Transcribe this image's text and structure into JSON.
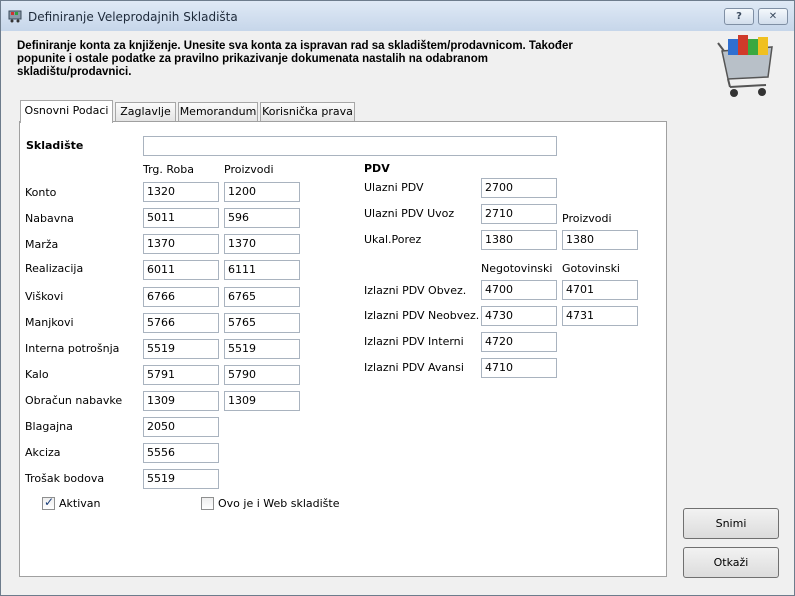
{
  "window": {
    "title": "Definiranje Veleprodajnih Skladišta",
    "help_icon": "?",
    "close_icon": "✕"
  },
  "hint": "Definiranje konta za knjiženje. Unesite sva konta za ispravan rad sa skladištem/prodavnicom. Također popunite i ostale podatke za pravilno prikazivanje dokumenata nastalih na odabranom skladištu/prodavnici.",
  "tabs": [
    "Osnovni Podaci",
    "Zaglavlje",
    "Memorandum",
    "Korisnička prava"
  ],
  "form": {
    "skladiste_label": "Skladište",
    "skladiste_value": "",
    "col_trg": "Trg. Roba",
    "col_proizvodi": "Proizvodi",
    "rows": [
      {
        "label": "Konto",
        "trg": "1320",
        "proizvodi": "1200"
      },
      {
        "label": "Nabavna",
        "trg": "5011",
        "proizvodi": "596"
      },
      {
        "label": "Marža",
        "trg": "1370",
        "proizvodi": "1370"
      },
      {
        "label": "Realizacija",
        "trg": "6011",
        "proizvodi": "6111"
      },
      {
        "label": "Viškovi",
        "trg": "6766",
        "proizvodi": "6765"
      },
      {
        "label": "Manjkovi",
        "trg": "5766",
        "proizvodi": "5765"
      },
      {
        "label": "Interna potrošnja",
        "trg": "5519",
        "proizvodi": "5519"
      },
      {
        "label": "Kalo",
        "trg": "5791",
        "proizvodi": "5790"
      },
      {
        "label": "Obračun nabavke",
        "trg": "1309",
        "proizvodi": "1309"
      },
      {
        "label": "Blagajna",
        "trg": "2050"
      },
      {
        "label": "Akciza",
        "trg": "5556"
      },
      {
        "label": "Trošak bodova",
        "trg": "5519"
      }
    ],
    "pdv": {
      "title": "PDV",
      "ulazni_label": "Ulazni PDV",
      "ulazni": "2700",
      "ulazni_uvoz_label": "Ulazni PDV Uvoz",
      "ulazni_uvoz": "2710",
      "proizvodi_label": "Proizvodi",
      "ukal_label": "Ukal.Porez",
      "ukal": "1380",
      "ukal_proizvodi": "1380",
      "col_negotovinski": "Negotovinski",
      "col_gotovinski": "Gotovinski",
      "izlazni_obvez_label": "Izlazni PDV Obvez.",
      "izlazni_obvez_neg": "4700",
      "izlazni_obvez_got": "4701",
      "izlazni_neobvez_label": "Izlazni PDV Neobvez.",
      "izlazni_neobvez_neg": "4730",
      "izlazni_neobvez_got": "4731",
      "izlazni_interni_label": "Izlazni PDV Interni",
      "izlazni_interni": "4720",
      "izlazni_avansi_label": "Izlazni PDV Avansi",
      "izlazni_avansi": "4710"
    },
    "aktivan_label": "Aktivan",
    "aktivan_checked": true,
    "web_label": "Ovo je i Web skladište",
    "web_checked": false
  },
  "buttons": {
    "save": "Snimi",
    "cancel": "Otkaži"
  }
}
